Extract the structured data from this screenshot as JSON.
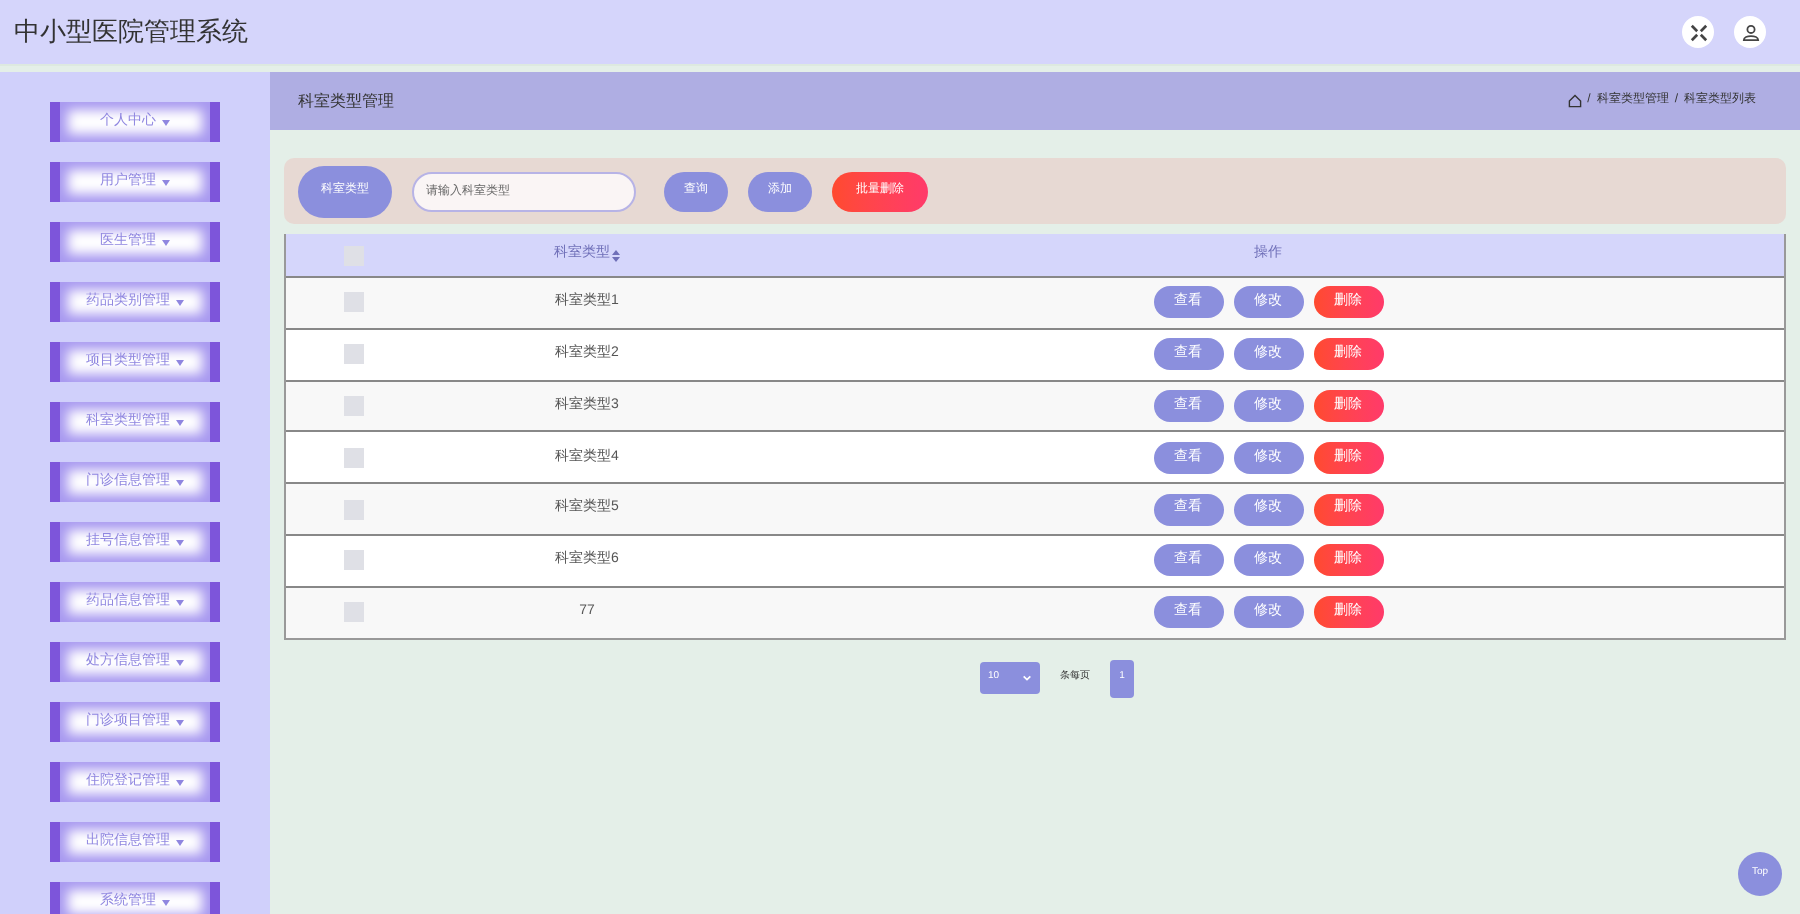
{
  "header": {
    "title": "中小型医院管理系统"
  },
  "sidebar": {
    "items": [
      {
        "label": "个人中心"
      },
      {
        "label": "用户管理"
      },
      {
        "label": "医生管理"
      },
      {
        "label": "药品类别管理"
      },
      {
        "label": "项目类型管理"
      },
      {
        "label": "科室类型管理"
      },
      {
        "label": "门诊信息管理"
      },
      {
        "label": "挂号信息管理"
      },
      {
        "label": "药品信息管理"
      },
      {
        "label": "处方信息管理"
      },
      {
        "label": "门诊项目管理"
      },
      {
        "label": "住院登记管理"
      },
      {
        "label": "出院信息管理"
      },
      {
        "label": "系统管理"
      }
    ]
  },
  "page": {
    "title": "科室类型管理",
    "breadcrumb": [
      "科室类型管理",
      "科室类型列表"
    ],
    "breadcrumb_separator": "/"
  },
  "search": {
    "label": "科室类型",
    "placeholder": "请输入科室类型",
    "buttons": [
      {
        "label": "查询",
        "kind": "normal"
      },
      {
        "label": "添加",
        "kind": "normal"
      },
      {
        "label": "批量删除",
        "kind": "danger"
      }
    ]
  },
  "table": {
    "columns": [
      "科室类型",
      "操作"
    ],
    "header_checked": false,
    "rows": [
      {
        "name": "科室类型1",
        "checked": false,
        "actions": [
          "查看",
          "修改",
          "删除"
        ]
      },
      {
        "name": "科室类型2",
        "checked": false,
        "actions": [
          "查看",
          "修改",
          "删除"
        ]
      },
      {
        "name": "科室类型3",
        "checked": false,
        "actions": [
          "查看",
          "修改",
          "删除"
        ]
      },
      {
        "name": "科室类型4",
        "checked": false,
        "actions": [
          "查看",
          "修改",
          "删除"
        ]
      },
      {
        "name": "科室类型5",
        "checked": false,
        "actions": [
          "查看",
          "修改",
          "删除"
        ]
      },
      {
        "name": "科室类型6",
        "checked": false,
        "actions": [
          "查看",
          "修改",
          "删除"
        ]
      },
      {
        "name": "77",
        "checked": false,
        "actions": [
          "查看",
          "修改",
          "删除"
        ]
      }
    ]
  },
  "pagination": {
    "page_size": "10",
    "page_size_label": "条每页",
    "pages": [
      {
        "label": "1",
        "selected": true
      }
    ]
  },
  "top_button": "Top"
}
